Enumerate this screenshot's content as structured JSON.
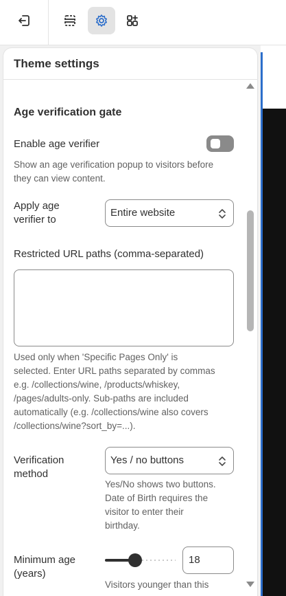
{
  "toolbar": {
    "exit_icon": "exit-icon",
    "sections_icon": "sections-icon",
    "settings_icon": "gear-icon",
    "apps_icon": "apps-add-icon",
    "active": "settings"
  },
  "panel": {
    "title": "Theme settings"
  },
  "age_gate": {
    "section_title": "Age verification gate",
    "enable_label": "Enable age verifier",
    "enable_value": false,
    "enable_help_1": "Show an age verification popup to visitors before",
    "enable_help_2": "they can view content.",
    "apply_label_1": "Apply age",
    "apply_label_2": "verifier to",
    "apply_value": "Entire website",
    "paths_label": "Restricted URL paths (comma-separated)",
    "paths_value": "",
    "paths_help": [
      "Used only when 'Specific Pages Only' is",
      "selected. Enter URL paths separated by commas",
      "e.g. /collections/wine, /products/whiskey,",
      "/pages/adults-only. Sub-paths are included",
      "automatically (e.g. /collections/wine also covers",
      "/collections/wine?sort_by=...)."
    ],
    "method_label_1": "Verification",
    "method_label_2": "method",
    "method_value": "Yes / no buttons",
    "method_help": [
      "Yes/No shows two buttons.",
      "Date of Birth requires the",
      "visitor to enter their",
      "birthday."
    ],
    "min_age_label_1": "Minimum age",
    "min_age_label_2": "(years)",
    "min_age_value": "18",
    "min_age_help": "Visitors younger than this"
  },
  "colors": {
    "accent": "#2c6ecb",
    "toggle_off": "#8a8a8a"
  }
}
